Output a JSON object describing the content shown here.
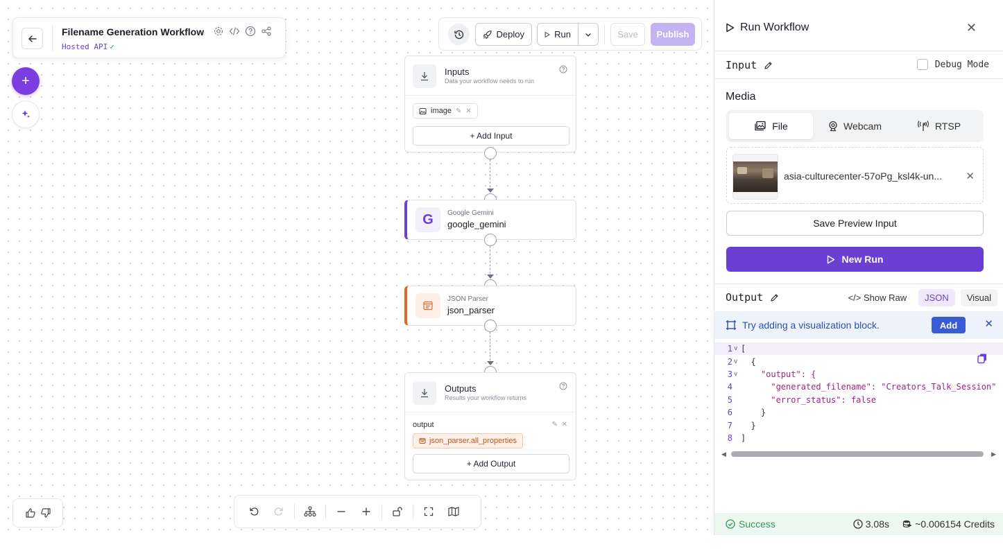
{
  "header": {
    "title": "Filename Generation Workflow",
    "subtitle": "Hosted API"
  },
  "toolbar": {
    "deploy_label": "Deploy",
    "run_label": "Run",
    "save_label": "Save",
    "publish_label": "Publish"
  },
  "nodes": {
    "inputs": {
      "title": "Inputs",
      "subtitle": "Data your workflow needs to run",
      "input_chip": "image",
      "add_label": "+ Add Input"
    },
    "gemini": {
      "type": "Google Gemini",
      "name": "google_gemini",
      "icon_letter": "G"
    },
    "json_parser": {
      "type": "JSON Parser",
      "name": "json_parser"
    },
    "outputs": {
      "title": "Outputs",
      "subtitle": "Results your workflow returns",
      "output_label": "output",
      "output_chip": "json_parser.all_properties",
      "add_label": "+ Add Output"
    }
  },
  "panel": {
    "title": "Run Workflow",
    "input_label": "Input",
    "debug_label": "Debug Mode",
    "media_label": "Media",
    "media_tabs": [
      {
        "label": "File",
        "active": true
      },
      {
        "label": "Webcam",
        "active": false
      },
      {
        "label": "RTSP",
        "active": false
      }
    ],
    "file_name": "asia-culturecenter-57oPg_ksl4k-un...",
    "save_preview_label": "Save Preview Input",
    "new_run_label": "New Run",
    "output_label": "Output",
    "show_raw_label": "Show Raw",
    "json_tab_label": "JSON",
    "visual_tab_label": "Visual",
    "tip_text": "Try adding a visualization block.",
    "tip_add_label": "Add",
    "code_lines": [
      {
        "n": "1",
        "fold": "v",
        "text": "["
      },
      {
        "n": "2",
        "fold": "v",
        "text": "  {"
      },
      {
        "n": "3",
        "fold": "v",
        "text": "    \"output\": {"
      },
      {
        "n": "4",
        "fold": "",
        "text": "      \"generated_filename\": \"Creators_Talk_Session\""
      },
      {
        "n": "5",
        "fold": "",
        "text": "      \"error_status\": false"
      },
      {
        "n": "6",
        "fold": "",
        "text": "    }"
      },
      {
        "n": "7",
        "fold": "",
        "text": "  }"
      },
      {
        "n": "8",
        "fold": "",
        "text": "]"
      }
    ],
    "status": "Success",
    "duration": "3.08s",
    "credits": "~0.006154 Credits"
  },
  "colors": {
    "accent": "#6b3fd1",
    "json_accent": "#d96a2b",
    "success": "#2e9c56"
  }
}
